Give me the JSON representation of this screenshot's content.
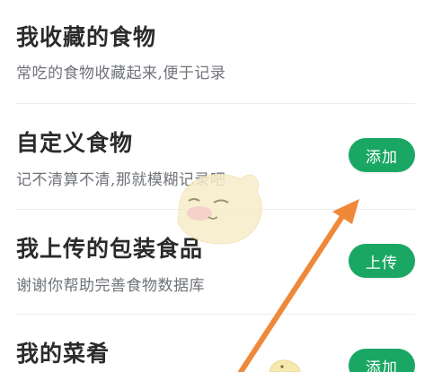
{
  "items": [
    {
      "title": "我收藏的食物",
      "subtitle": "常吃的食物收藏起来,便于记录",
      "button": ""
    },
    {
      "title": "自定义食物",
      "subtitle": "记不清算不清,那就模糊记录吧",
      "button": "添加"
    },
    {
      "title": "我上传的包装食品",
      "subtitle": "谢谢你帮助完善食物数据库",
      "button": "上传"
    },
    {
      "title": "我的菜肴",
      "subtitle": "",
      "button": "添加"
    }
  ],
  "colors": {
    "button": "#1aa764",
    "arrow": "#f0883a",
    "mascot": "#f6edc8"
  }
}
